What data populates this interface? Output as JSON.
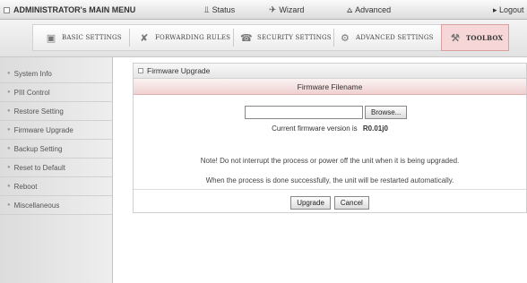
{
  "topbar": {
    "title": "ADMINISTRATOR's MAIN MENU",
    "items": [
      {
        "label": "Status",
        "icon": "status-icon"
      },
      {
        "label": "Wizard",
        "icon": "wizard-icon"
      },
      {
        "label": "Advanced",
        "icon": "advanced-icon"
      }
    ],
    "logout": "▸ Logout"
  },
  "tabs": [
    {
      "label": "BASIC SETTINGS",
      "icon": "basic-settings-icon"
    },
    {
      "label": "FORWARDING RULES",
      "icon": "forwarding-rules-icon"
    },
    {
      "label": "SECURITY SETTINGS",
      "icon": "security-settings-icon"
    },
    {
      "label": "ADVANCED SETTINGS",
      "icon": "advanced-settings-icon"
    },
    {
      "label": "TOOLBOX",
      "icon": "toolbox-icon",
      "active": true
    }
  ],
  "sidebar": {
    "items": [
      {
        "label": "System Info"
      },
      {
        "label": "PIII Control"
      },
      {
        "label": "Restore Setting"
      },
      {
        "label": "Firmware Upgrade"
      },
      {
        "label": "Backup Setting"
      },
      {
        "label": "Reset to Default"
      },
      {
        "label": "Reboot"
      },
      {
        "label": "Miscellaneous"
      }
    ]
  },
  "panel": {
    "title": "Firmware Upgrade",
    "column_header": "Firmware Filename",
    "file_value": "",
    "browse_label": "Browse...",
    "version_label": "Current firmware version is",
    "version_value": "R0.01j0",
    "note1": "Note! Do not interrupt the process or power off the unit when it is being upgraded.",
    "note2": "When the process is done successfully, the unit will be restarted automatically.",
    "upgrade_label": "Upgrade",
    "cancel_label": "Cancel"
  }
}
